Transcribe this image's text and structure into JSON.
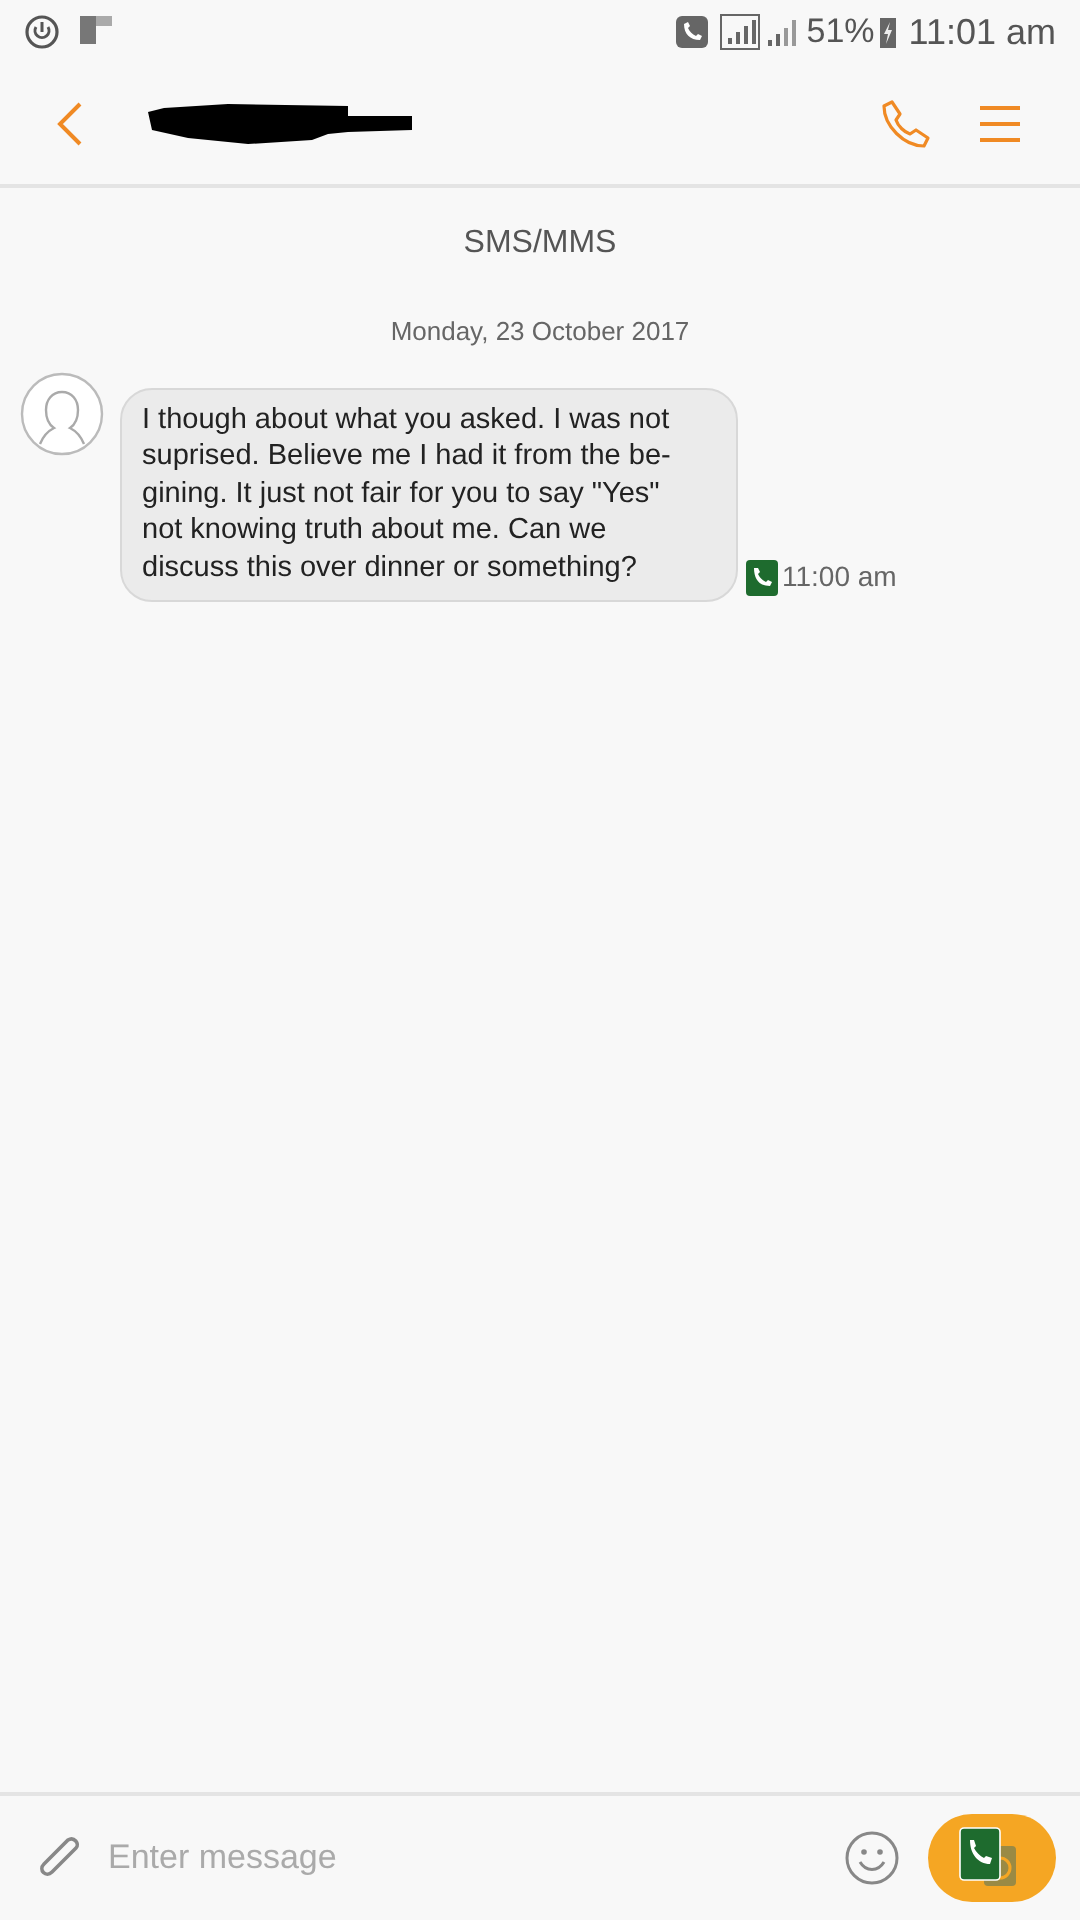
{
  "status_bar": {
    "battery": "51%",
    "time": "11:01 am"
  },
  "header": {
    "contact_redacted": true
  },
  "conversation": {
    "channel": "SMS/MMS",
    "date": "Monday, 23 October 2017",
    "messages": [
      {
        "text": "I though about what you asked. I was not\nsuprised. Believe me I had it from the be-\ngining. It just not fair for you to say \"Yes\"\nnot knowing truth about me. Can we\ndiscuss this over dinner or something?",
        "time": "11:00 am"
      }
    ]
  },
  "composer": {
    "placeholder": "Enter message"
  }
}
